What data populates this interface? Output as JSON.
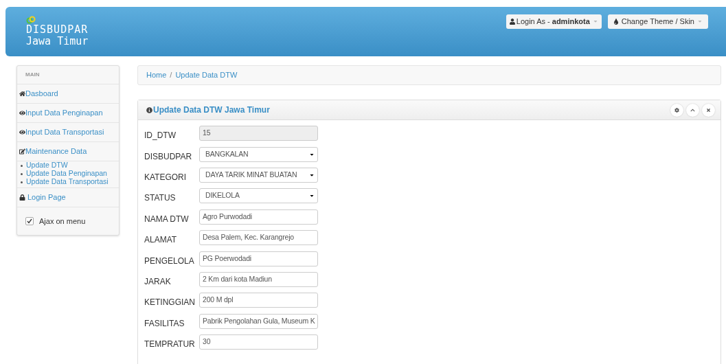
{
  "brand": {
    "line1": "DISBUDPAR",
    "line2": "Jawa Timur"
  },
  "navbar": {
    "login": {
      "prefix": "Login As - ",
      "user": "adminkota"
    },
    "theme": "Change Theme / Skin"
  },
  "sidebar": {
    "header": "MAIN",
    "items": [
      {
        "label": "Dasboard",
        "kind": "home"
      },
      {
        "label": "Input Data Penginapan",
        "kind": "view"
      },
      {
        "label": "Input Data Transportasi",
        "kind": "view"
      },
      {
        "label": "Maintenance Data",
        "kind": "edit",
        "children": [
          {
            "label": "Update DTW"
          },
          {
            "label": "Update Data Penginapan"
          },
          {
            "label": "Update Data Transportasi"
          }
        ]
      },
      {
        "label": "Login Page",
        "kind": "lock"
      }
    ],
    "ajax": {
      "label": "Ajax on menu",
      "checked": true
    }
  },
  "breadcrumb": {
    "separator": "/",
    "items": [
      "Home",
      "Update Data DTW"
    ]
  },
  "panel": {
    "title": "Update Data DTW Jawa Timur",
    "fields": [
      {
        "label": "ID_DTW",
        "kind": "readonly",
        "value": "15"
      },
      {
        "label": "DISBUDPAR",
        "kind": "select",
        "value": "BANGKALAN"
      },
      {
        "label": "KATEGORI",
        "kind": "select",
        "value": "DAYA TARIK MINAT BUATAN"
      },
      {
        "label": "STATUS",
        "kind": "select",
        "value": "DIKELOLA"
      },
      {
        "label": "NAMA DTW",
        "kind": "text",
        "value": "Agro Purwodadi"
      },
      {
        "label": "ALAMAT",
        "kind": "text",
        "value": "Desa Palem, Kec. Karangrejo"
      },
      {
        "label": "PENGELOLA",
        "kind": "text",
        "value": "PG Poerwodadi"
      },
      {
        "label": "JARAK",
        "kind": "text",
        "value": "2 Km dari kota Madiun"
      },
      {
        "label": "KETINGGIAN",
        "kind": "text",
        "value": "200 M dpl"
      },
      {
        "label": "FASILITAS",
        "kind": "text",
        "value": "Pabrik Pengolahan Gula, Museum K"
      },
      {
        "label": "TEMPRATUR",
        "kind": "text",
        "value": "30"
      }
    ]
  }
}
